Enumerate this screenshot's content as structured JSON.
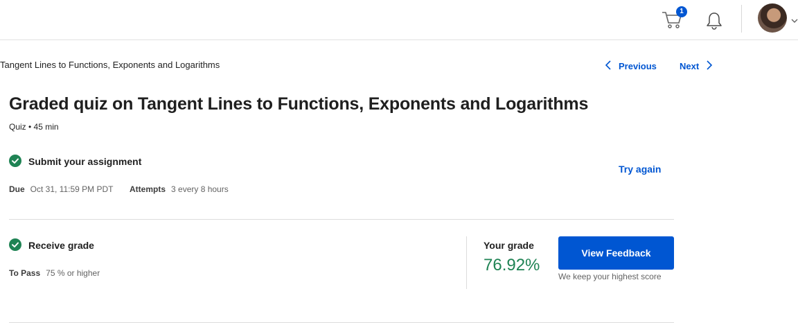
{
  "header": {
    "cart_count": "1",
    "icons": [
      "cart-icon",
      "bell-icon",
      "avatar",
      "chevron-down-icon"
    ]
  },
  "breadcrumb": "Tangent Lines to Functions, Exponents and Logarithms",
  "navigation": {
    "previous_label": "Previous",
    "next_label": "Next"
  },
  "page": {
    "title": "Graded quiz on Tangent Lines to Functions, Exponents and Logarithms",
    "meta": "Quiz • 45 min"
  },
  "submit_section": {
    "heading": "Submit your assignment",
    "due_label": "Due",
    "due_value": "Oct 31, 11:59 PM PDT",
    "attempts_label": "Attempts",
    "attempts_value": "3 every 8 hours",
    "try_again_label": "Try again"
  },
  "grade_section": {
    "heading": "Receive grade",
    "to_pass_label": "To Pass",
    "to_pass_value": "75 % or higher",
    "your_grade_label": "Your grade",
    "grade_value": "76.92%",
    "feedback_button": "View Feedback",
    "note": "We keep your highest score"
  },
  "colors": {
    "accent": "#0056d2",
    "success": "#1f8354",
    "text": "#1f1f1f",
    "muted": "#636363"
  }
}
